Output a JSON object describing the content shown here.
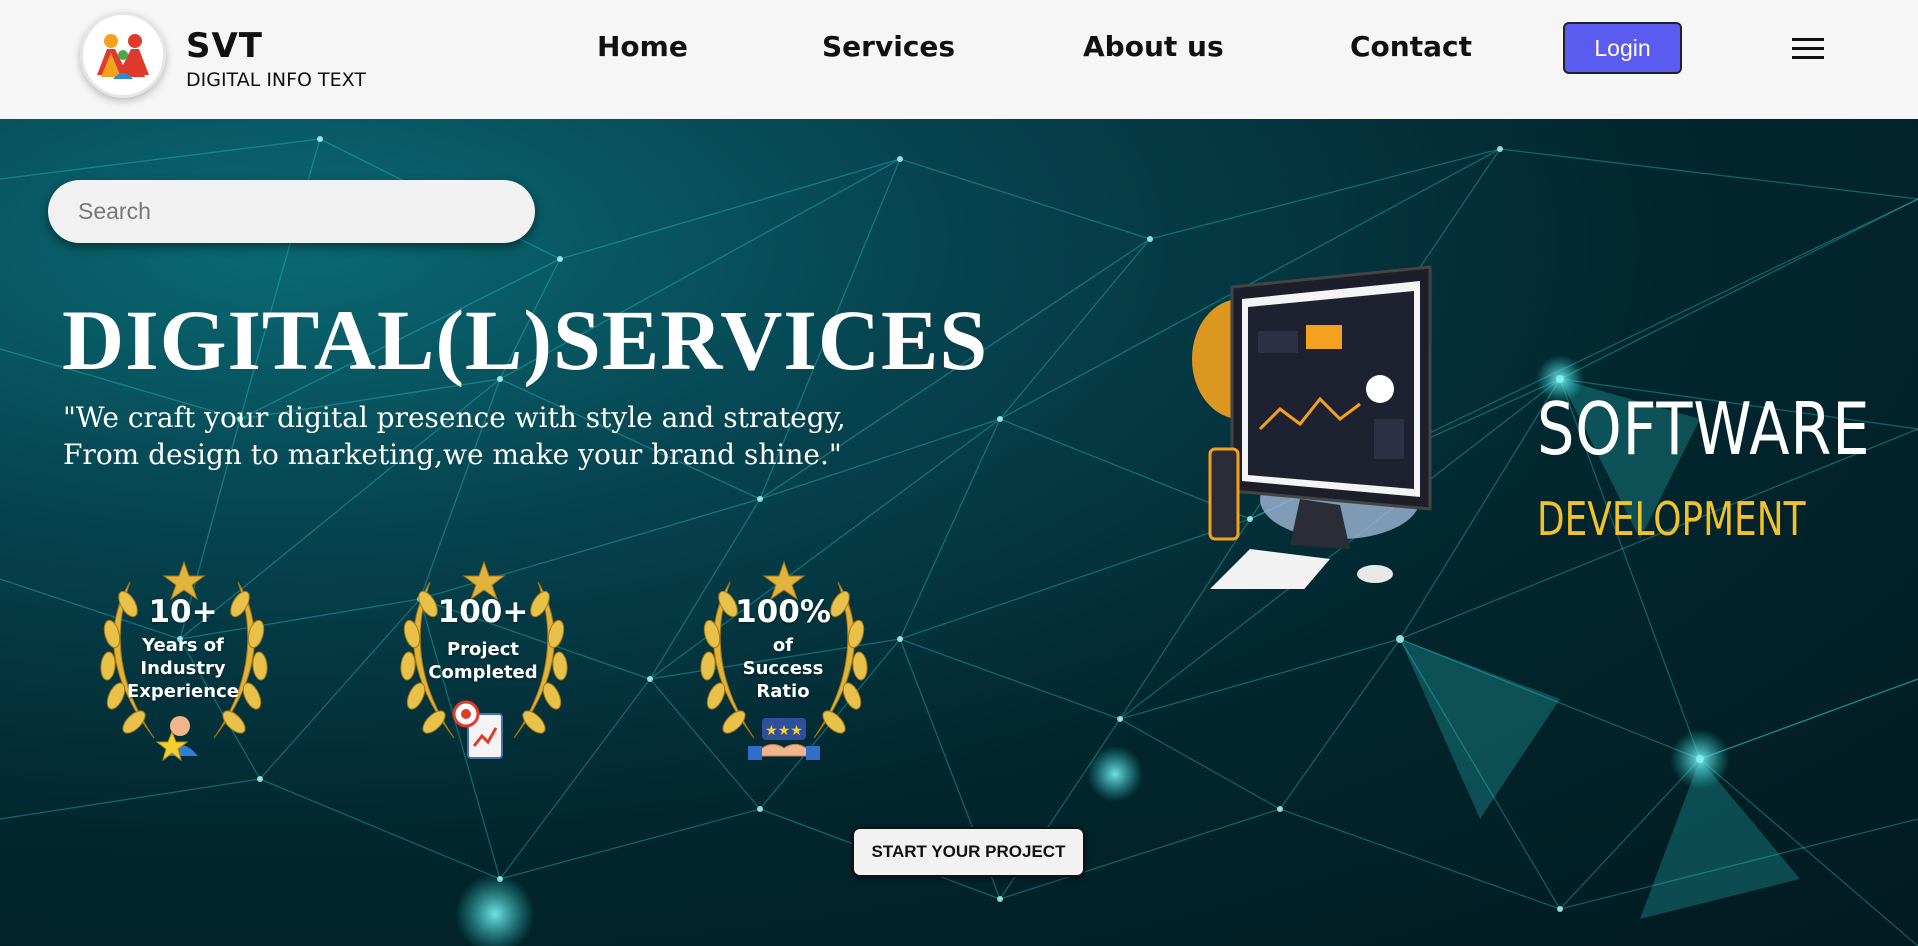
{
  "brand": {
    "name": "SVT",
    "tagline": "DIGITAL INFO TEXT"
  },
  "nav": {
    "items": [
      {
        "label": "Home"
      },
      {
        "label": "Services"
      },
      {
        "label": "About us"
      },
      {
        "label": "Contact"
      }
    ],
    "login_label": "Login",
    "menu_icon": "hamburger-menu-icon"
  },
  "hero": {
    "search_placeholder": "Search",
    "title": "DIGITAL(L)SERVICES",
    "quote_line1": "\"We craft your digital presence with style and strategy,",
    "quote_line2": "From design to marketing,we make your brand shine.\"",
    "badges": [
      {
        "value": "10+",
        "lines": [
          "Years of",
          "Industry",
          "Experience"
        ],
        "icon": "worker-star-icon"
      },
      {
        "value": "100+",
        "lines": [
          "Project",
          "Completed"
        ],
        "icon": "target-clipboard-icon"
      },
      {
        "value": "100%",
        "lines": [
          "of",
          "Success",
          "Ratio"
        ],
        "icon": "handshake-stars-icon"
      }
    ],
    "cta_label": "START YOUR PROJECT",
    "promo_line1": "SOFTWARE",
    "promo_line2": "DEVELOPMENT"
  },
  "colors": {
    "accent": "#5a5cf0",
    "hero_bg": "#02262e",
    "network": "#2fd6d6",
    "gold": "#e2b33a",
    "promo_yellow": "#f1c22a"
  }
}
